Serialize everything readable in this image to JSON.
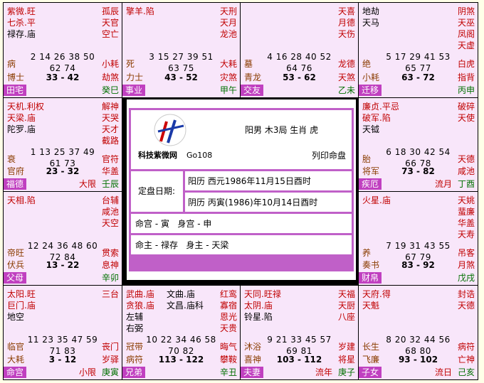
{
  "cells": {
    "c1": {
      "left": [
        "紫微.旺",
        "七杀.平",
        "禄存.庙"
      ],
      "right": [
        "孤辰",
        "天官",
        "空亡"
      ],
      "nums1": "2 14 26 38 50",
      "nums2": "62 74",
      "midL": "病",
      "midR": "小耗",
      "botL": "博士",
      "botM": "33 - 42",
      "botR": "劫煞",
      "tag": "田宅",
      "fr": "癸巳",
      "fr2": ""
    },
    "c2": {
      "left": [
        "擎羊.陷"
      ],
      "right": [
        "天刑",
        "天月",
        "龙池"
      ],
      "nums1": "3 15 27 39 51",
      "nums2": "63 75",
      "midL": "死",
      "midR": "大耗",
      "botL": "力士",
      "botM": "43 - 52",
      "botR": "灾煞",
      "tag": "事业",
      "fr": "甲午",
      "fr2": ""
    },
    "c3": {
      "left": [],
      "right": [
        "天喜",
        "月德",
        "天伤"
      ],
      "nums1": "4 16 28 40 52",
      "nums2": "64 76",
      "midL": "墓",
      "midR": "龙德",
      "botL": "青龙",
      "botM": "53 - 62",
      "botR": "天煞",
      "tag": "交友",
      "fr": "乙未",
      "fr2": ""
    },
    "c4": {
      "left": [
        "地劫",
        "天马"
      ],
      "right": [
        "阴煞",
        "天巫",
        "凤阁",
        "天虚"
      ],
      "nums1": "5 17 29 41 53",
      "nums2": "65 77",
      "midL": "绝",
      "midR": "白虎",
      "botL": "小耗",
      "botM": "63 - 72",
      "botR": "指背",
      "tag": "迁移",
      "fr": "丙申",
      "fr2": ""
    },
    "c5": {
      "left": [
        "天机.利权",
        "天梁.庙",
        "陀罗.庙"
      ],
      "right": [
        "解神",
        "天哭",
        "天才",
        "截路"
      ],
      "nums1": "1 13 25 37 49",
      "nums2": "61 73",
      "midL": "衰",
      "midR": "官符",
      "botL": "官府",
      "botM": "23 - 32",
      "botR": "华盖",
      "tag": "福德",
      "fr": "壬辰",
      "fr2": "大限"
    },
    "c6": {
      "left": [
        "廉贞.平忌",
        "破军.陷",
        "天钺"
      ],
      "right": [
        "破碎",
        "天使"
      ],
      "nums1": "6 18 30 42 54",
      "nums2": "66 78",
      "midL": "胎",
      "midR": "天德",
      "botL": "将军",
      "botM": "73 - 82",
      "botR": "咸池",
      "tag": "疾厄",
      "fr": "丁酉",
      "fr2": "流月"
    },
    "c7": {
      "left": [
        "天相.陷"
      ],
      "right": [
        "台辅",
        "咸池",
        "天空"
      ],
      "nums1": "12 24 36 48 60",
      "nums2": "72 84",
      "midL": "帝旺",
      "midR": "贯索",
      "botL": "伏兵",
      "botM": "13 - 22",
      "botR": "息神",
      "tag": "父母",
      "fr": "辛卯",
      "fr2": ""
    },
    "c8": {
      "left": [
        "火星.庙"
      ],
      "right": [
        "天姚",
        "蜚廉",
        "华盖",
        "天寿"
      ],
      "nums1": "7 19 31 43 55",
      "nums2": "67 79",
      "midL": "养",
      "midR": "吊客",
      "botL": "奏书",
      "botM": "83 - 92",
      "botR": "月煞",
      "tag": "财帛",
      "fr": "戊戌",
      "fr2": ""
    },
    "c9": {
      "left": [
        "太阳.旺",
        "巨门.庙",
        "地空"
      ],
      "right": [
        "三台"
      ],
      "nums1": "11 23 35 47 59",
      "nums2": "71 83",
      "midL": "临官",
      "midR": "丧门",
      "botL": "大耗",
      "botM": "3 - 12",
      "botR": "岁驿",
      "tag": "命宫",
      "fr": "庚寅",
      "fr2": "小限"
    },
    "c10": {
      "left": [
        "武曲.庙",
        "贪狼.庙",
        "左辅",
        "右弼"
      ],
      "left2": [
        "文曲.庙",
        "文昌.庙科"
      ],
      "right": [
        "红鸾",
        "寡宿",
        "恩光",
        "天贵"
      ],
      "nums1": "10 22 34 46 58",
      "nums2": "70 82",
      "midL": "冠带",
      "midR": "晦气",
      "botL": "病符",
      "botM": "113 - 122",
      "botR": "攀鞍",
      "tag": "兄弟",
      "fr": "辛丑",
      "fr2": ""
    },
    "c11": {
      "left": [
        "天同.旺禄",
        "太阴.庙",
        "铃星.陷"
      ],
      "right": [
        "天福",
        "天厨",
        "八座"
      ],
      "nums1": "9 21 33 45 57",
      "nums2": "69 81",
      "midL": "沐浴",
      "midR": "岁建",
      "botL": "喜神",
      "botM": "103 - 112",
      "botR": "将星",
      "tag": "夫妻",
      "fr": "庚子",
      "fr2": "流年"
    },
    "c12": {
      "left": [
        "天府.得",
        "天魁"
      ],
      "right": [
        "封诰",
        "天德"
      ],
      "nums1": "8 20 32 44 56",
      "nums2": "68 80",
      "midL": "长生",
      "midR": "病符",
      "botL": "飞廉",
      "botM": "93 - 102",
      "botR": "亡神",
      "tag": "子女",
      "fr": "己亥",
      "fr2": "流日"
    }
  },
  "center": {
    "brand": "科技紫微网",
    "code": "Go108",
    "profile": "阳男 木3局 生肖 虎",
    "subtitle": "列印命盘",
    "date_label": "定盘日期:",
    "solar": "阳历 西元1986年11月15日酉时",
    "lunar": "阴历 丙寅(1986)年10月14日酉时",
    "palace": "命宫 - 寅   身宫 - 申",
    "master": "命主 - 禄存   身主 - 天梁"
  },
  "colors": {
    "grid": "#000000",
    "cell": "#f8e6fa",
    "tag": "#c040c0",
    "red": "#c00000",
    "green": "#007000"
  }
}
